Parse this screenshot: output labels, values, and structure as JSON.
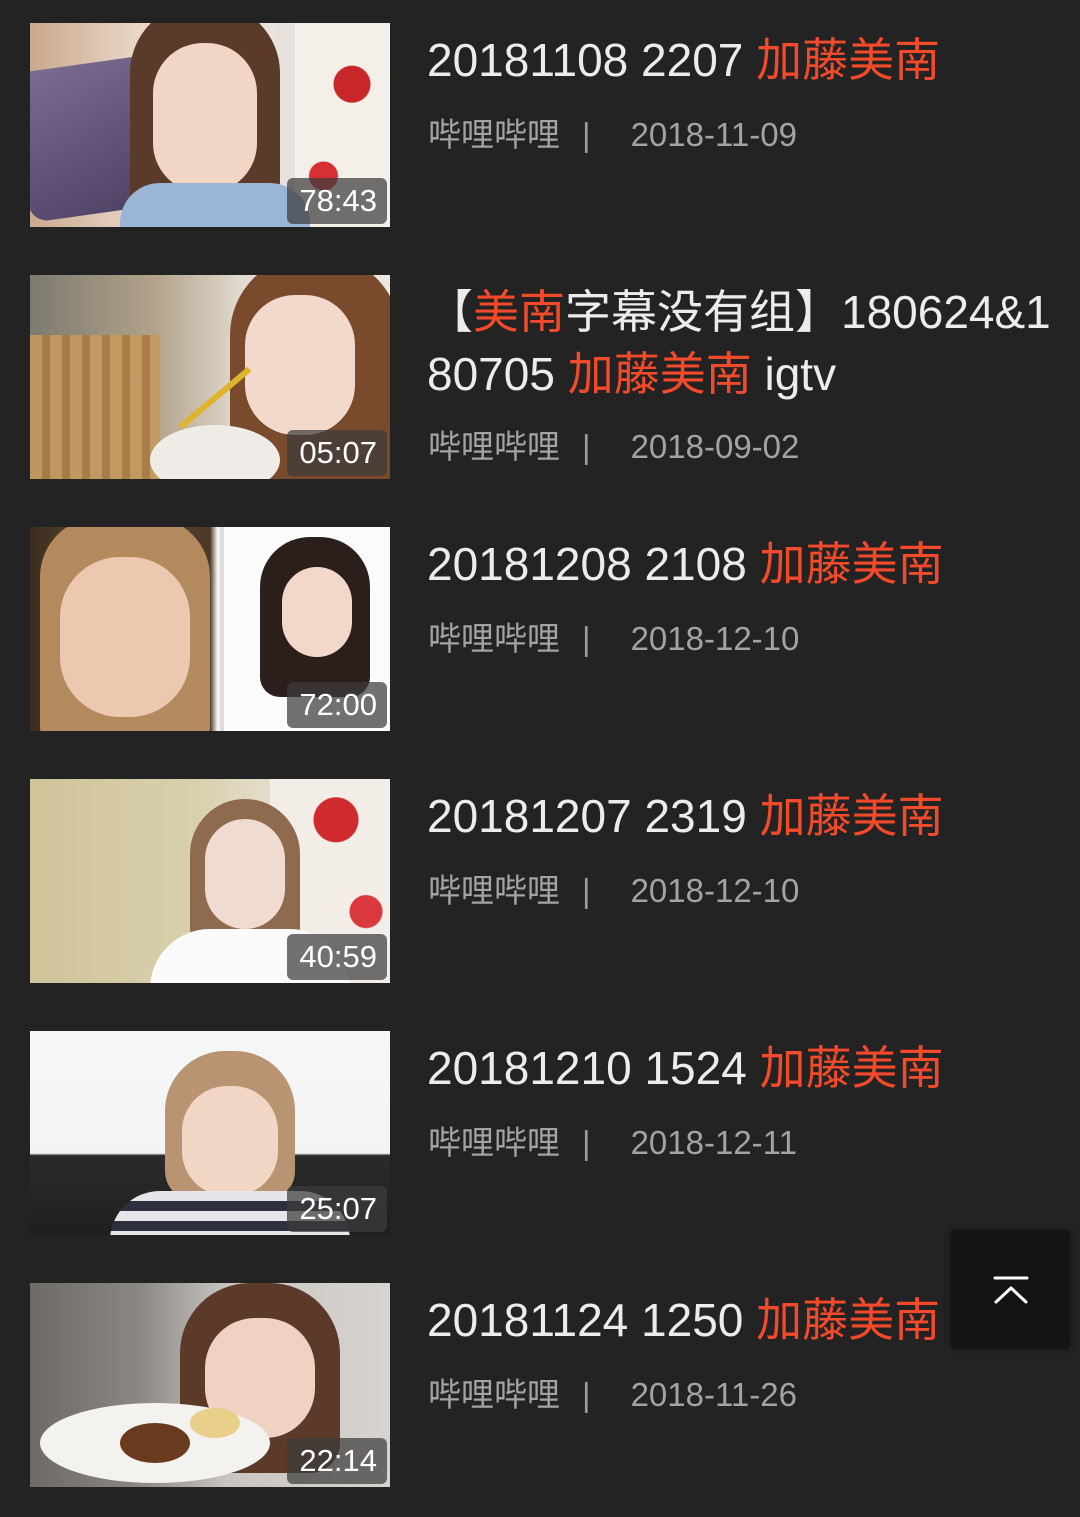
{
  "videos": [
    {
      "title_prefix": "20181108 2207 ",
      "title_highlight": "加藤美南",
      "title_suffix": "",
      "source": "哔哩哔哩",
      "separator": "|",
      "date": "2018-11-09",
      "duration": "78:43"
    },
    {
      "title_open": "【",
      "title_highlight_a": "美南",
      "title_mid": "字幕没有组】180624&180705 ",
      "title_highlight_b": "加藤美南",
      "title_suffix": " igtv",
      "source": "哔哩哔哩",
      "separator": "|",
      "date": "2018-09-02",
      "duration": "05:07"
    },
    {
      "title_prefix": "20181208 2108 ",
      "title_highlight": "加藤美南",
      "title_suffix": "",
      "source": "哔哩哔哩",
      "separator": "|",
      "date": "2018-12-10",
      "duration": "72:00"
    },
    {
      "title_prefix": "20181207 2319 ",
      "title_highlight": "加藤美南",
      "title_suffix": "",
      "source": "哔哩哔哩",
      "separator": "|",
      "date": "2018-12-10",
      "duration": "40:59"
    },
    {
      "title_prefix": "20181210 1524 ",
      "title_highlight": "加藤美南",
      "title_suffix": "",
      "source": "哔哩哔哩",
      "separator": "|",
      "date": "2018-12-11",
      "duration": "25:07"
    },
    {
      "title_prefix": "20181124 1250 ",
      "title_highlight": "加藤美南",
      "title_suffix": "",
      "source": "哔哩哔哩",
      "separator": "|",
      "date": "2018-11-26",
      "duration": "22:14"
    }
  ],
  "back_to_top": {
    "icon": "arrow-up-to-top-icon"
  },
  "colors": {
    "background": "#232323",
    "highlight": "#f24a2a",
    "title": "#ececec",
    "meta": "#a3a3a3"
  }
}
